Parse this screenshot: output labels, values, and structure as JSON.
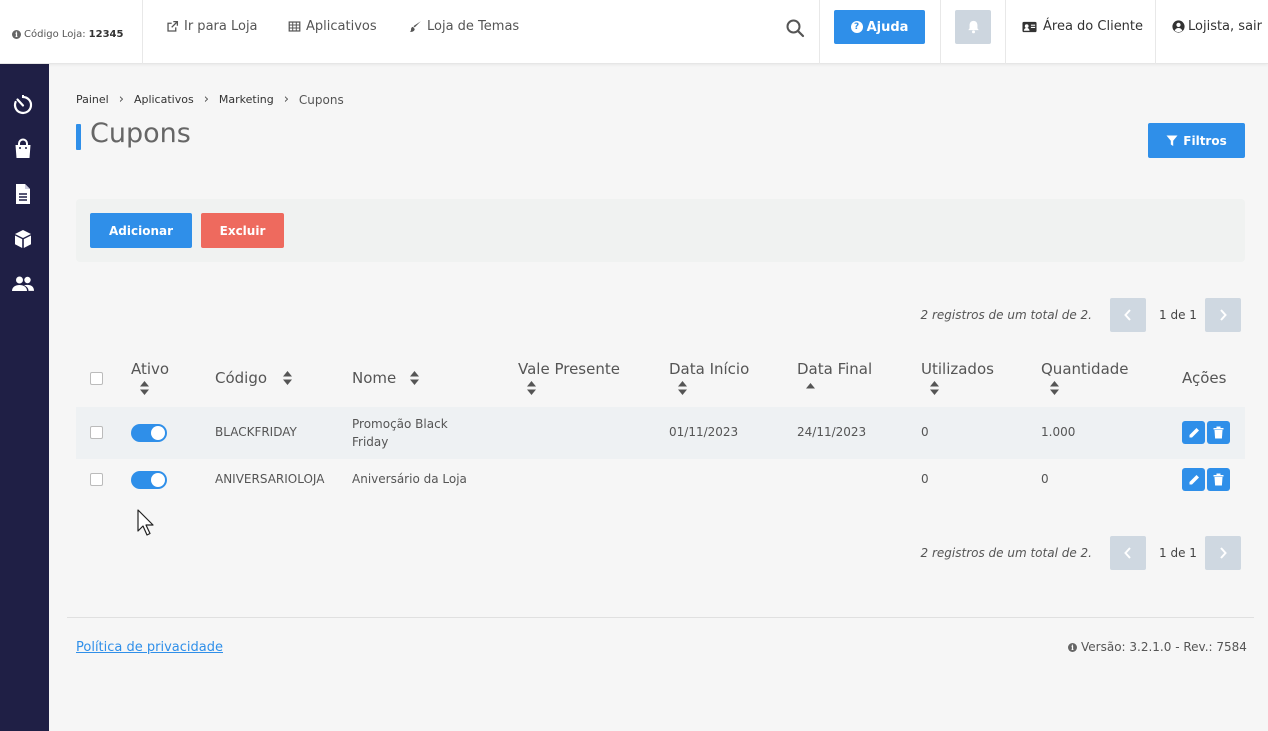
{
  "header": {
    "store_code_label": "Código Loja:",
    "store_code_value": "12345",
    "nav": {
      "go_to_store": "Ir para Loja",
      "apps": "Aplicativos",
      "themes": "Loja de Temas"
    },
    "help_label": "Ajuda",
    "client_area": "Área do Cliente",
    "logout": "Lojista, sair"
  },
  "sidebar": {
    "items": [
      {
        "icon": "dashboard-timer-icon"
      },
      {
        "icon": "shopping-bag-icon"
      },
      {
        "icon": "document-icon"
      },
      {
        "icon": "box-icon"
      },
      {
        "icon": "users-icon"
      }
    ]
  },
  "breadcrumb": [
    "Painel",
    "Aplicativos",
    "Marketing",
    "Cupons"
  ],
  "page": {
    "title": "Cupons",
    "filter_label": "Filtros",
    "add_label": "Adicionar",
    "delete_label": "Excluir"
  },
  "pagination": {
    "info": "2 registros de um total de 2.",
    "page": "1 de 1"
  },
  "table": {
    "columns": [
      "Ativo",
      "Código",
      "Nome",
      "Vale Presente",
      "Data Início",
      "Data Final",
      "Utilizados",
      "Quantidade",
      "Ações"
    ],
    "rows": [
      {
        "active": true,
        "code": "BLACKFRIDAY",
        "name": "Promoção Black Friday",
        "gift": "",
        "start": "01/11/2023",
        "end": "24/11/2023",
        "used": "0",
        "quantity": "1.000"
      },
      {
        "active": true,
        "code": "ANIVERSARIOLOJA",
        "name": "Aniversário da Loja",
        "gift": "",
        "start": "",
        "end": "",
        "used": "0",
        "quantity": "0"
      }
    ]
  },
  "footer": {
    "privacy": "Política de privacidade",
    "version": "Versão: 3.2.1.0 - Rev.: 7584"
  },
  "colors": {
    "primary": "#2f8fe9",
    "danger": "#ee6a5e",
    "sidebar": "#1f1f45",
    "disabled": "#cfd8e1"
  }
}
